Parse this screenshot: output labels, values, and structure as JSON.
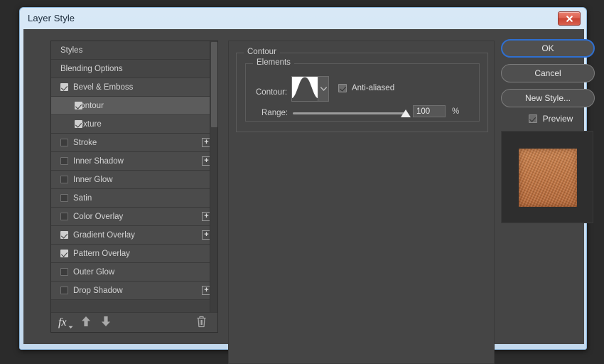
{
  "window": {
    "title": "Layer Style",
    "close_icon": "close-x-icon"
  },
  "styles_panel": {
    "items": [
      {
        "label": "Styles",
        "checkbox": "none",
        "indent": false,
        "plus": false,
        "selected": false
      },
      {
        "label": "Blending Options",
        "checkbox": "none",
        "indent": false,
        "plus": false,
        "selected": false
      },
      {
        "label": "Bevel & Emboss",
        "checkbox": "checked",
        "indent": false,
        "plus": false,
        "selected": false
      },
      {
        "label": "Contour",
        "checkbox": "checked",
        "indent": true,
        "plus": false,
        "selected": true
      },
      {
        "label": "Texture",
        "checkbox": "checked",
        "indent": true,
        "plus": false,
        "selected": false
      },
      {
        "label": "Stroke",
        "checkbox": "unchecked",
        "indent": false,
        "plus": true,
        "selected": false
      },
      {
        "label": "Inner Shadow",
        "checkbox": "unchecked",
        "indent": false,
        "plus": true,
        "selected": false
      },
      {
        "label": "Inner Glow",
        "checkbox": "unchecked",
        "indent": false,
        "plus": false,
        "selected": false
      },
      {
        "label": "Satin",
        "checkbox": "unchecked",
        "indent": false,
        "plus": false,
        "selected": false
      },
      {
        "label": "Color Overlay",
        "checkbox": "unchecked",
        "indent": false,
        "plus": true,
        "selected": false
      },
      {
        "label": "Gradient Overlay",
        "checkbox": "checked",
        "indent": false,
        "plus": true,
        "selected": false
      },
      {
        "label": "Pattern Overlay",
        "checkbox": "checked",
        "indent": false,
        "plus": false,
        "selected": false
      },
      {
        "label": "Outer Glow",
        "checkbox": "unchecked",
        "indent": false,
        "plus": false,
        "selected": false
      },
      {
        "label": "Drop Shadow",
        "checkbox": "unchecked",
        "indent": false,
        "plus": true,
        "selected": false
      }
    ],
    "plus_label": "+",
    "toolbar": {
      "fx_label": "fx",
      "fx_icon": "fx-menu-icon",
      "move_up_icon": "arrow-up-icon",
      "move_down_icon": "arrow-down-icon",
      "delete_icon": "trash-icon"
    }
  },
  "settings": {
    "group_title": "Contour",
    "elements_title": "Elements",
    "contour": {
      "label": "Contour:",
      "picker_icon": "contour-curve-thumbnail",
      "dropdown_icon": "chevron-down-icon"
    },
    "antialias": {
      "label": "Anti-aliased",
      "checked": true
    },
    "range": {
      "label": "Range:",
      "value": "100",
      "unit": "%",
      "min": 0,
      "max": 100,
      "slider_icon": "slider-thumb-triangle"
    }
  },
  "actions": {
    "ok": "OK",
    "cancel": "Cancel",
    "new_style": "New Style...",
    "preview_label": "Preview",
    "preview_checked": true
  },
  "preview": {
    "swatch_icon": "orange-texture-swatch"
  },
  "colors": {
    "accent_focus": "#2f6fd0",
    "dialog_bg": "#454545",
    "list_row": "#4b4b4b",
    "list_row_selected": "#5c5c5c",
    "titlebar_top": "#d8e8f6",
    "titlebar_bottom": "#c3d9ee",
    "close_button": "#d9604e",
    "swatch_orange": "#cd7a41",
    "preview_bg": "#2e2e2e"
  }
}
